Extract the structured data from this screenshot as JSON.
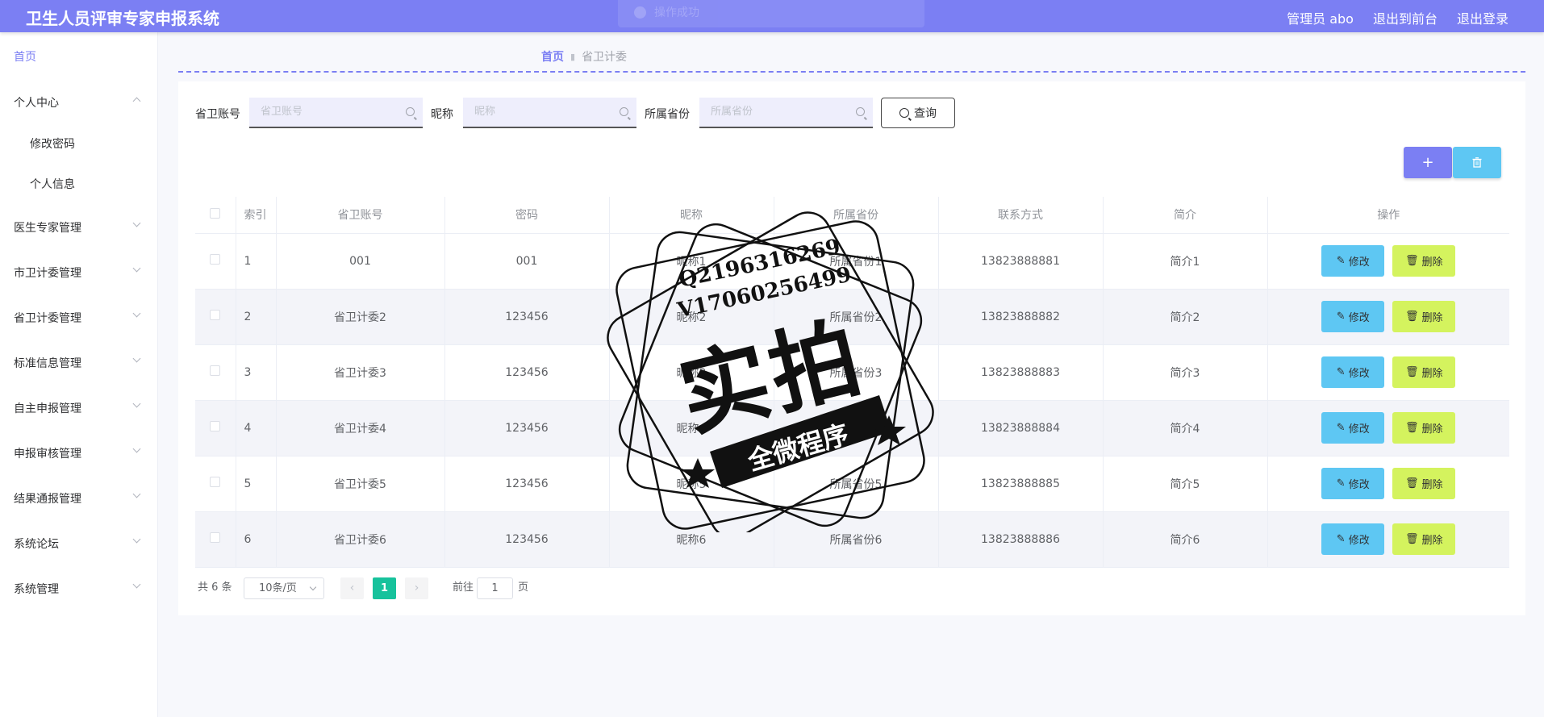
{
  "header": {
    "app_title": "卫生人员评审专家申报系统",
    "toast_text": "操作成功",
    "admin_label": "管理员 abo",
    "front_link": "退出到前台",
    "logout_link": "退出登录"
  },
  "sidebar": {
    "home": "首页",
    "personal_center": "个人中心",
    "change_password": "修改密码",
    "personal_info": "个人信息",
    "items": [
      "医生专家管理",
      "市卫计委管理",
      "省卫计委管理",
      "标准信息管理",
      "自主申报管理",
      "申报审核管理",
      "结果通报管理",
      "系统论坛",
      "系统管理"
    ]
  },
  "breadcrumb": {
    "home": "首页",
    "current": "省卫计委"
  },
  "search": {
    "account_label": "省卫账号",
    "account_placeholder": "省卫账号",
    "nickname_label": "昵称",
    "nickname_placeholder": "昵称",
    "province_label": "所属省份",
    "province_placeholder": "所属省份",
    "query_button": "查询"
  },
  "toolbar": {
    "add_label": "+",
    "delete_icon": "trash-icon"
  },
  "table": {
    "columns": [
      "索引",
      "省卫账号",
      "密码",
      "昵称",
      "所属省份",
      "联系方式",
      "简介",
      "操作"
    ],
    "rows": [
      {
        "idx": "1",
        "account": "001",
        "password": "001",
        "nickname": "昵称1",
        "province": "所属省份1",
        "phone": "13823888881",
        "intro": "简介1"
      },
      {
        "idx": "2",
        "account": "省卫计委2",
        "password": "123456",
        "nickname": "昵称2",
        "province": "所属省份2",
        "phone": "13823888882",
        "intro": "简介2"
      },
      {
        "idx": "3",
        "account": "省卫计委3",
        "password": "123456",
        "nickname": "昵称3",
        "province": "所属省份3",
        "phone": "13823888883",
        "intro": "简介3"
      },
      {
        "idx": "4",
        "account": "省卫计委4",
        "password": "123456",
        "nickname": "昵称4",
        "province": "所属省份4",
        "phone": "13823888884",
        "intro": "简介4"
      },
      {
        "idx": "5",
        "account": "省卫计委5",
        "password": "123456",
        "nickname": "昵称5",
        "province": "所属省份5",
        "phone": "13823888885",
        "intro": "简介5"
      },
      {
        "idx": "6",
        "account": "省卫计委6",
        "password": "123456",
        "nickname": "昵称6",
        "province": "所属省份6",
        "phone": "13823888886",
        "intro": "简介6"
      }
    ],
    "edit_label": "修改",
    "delete_label": "删除"
  },
  "pagination": {
    "total_text": "共 6 条",
    "page_size": "10条/页",
    "current_page": "1",
    "goto_prefix": "前往",
    "goto_value": "1",
    "goto_suffix": "页"
  },
  "watermark": {
    "line1": "Q2196316269",
    "line2": "V17060256499",
    "main": "实拍",
    "sub": "全微程序"
  }
}
